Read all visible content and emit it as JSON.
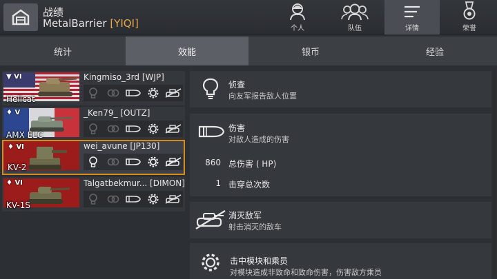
{
  "header": {
    "title": "战绩",
    "player_name": "MetalBarrier",
    "player_clan": "[YIQI]",
    "tabs": [
      {
        "label": "个人",
        "icon": "soldier-icon",
        "active": false
      },
      {
        "label": "队伍",
        "icon": "team-icon",
        "active": false
      },
      {
        "label": "详情",
        "icon": "list-icon",
        "active": true
      },
      {
        "label": "荣誉",
        "icon": "medal-icon",
        "active": false
      }
    ]
  },
  "subtabs": [
    {
      "label": "统计",
      "active": false
    },
    {
      "label": "效能",
      "active": true
    },
    {
      "label": "银币",
      "active": false
    },
    {
      "label": "经验",
      "active": false
    }
  ],
  "players": [
    {
      "tier": "▼ VI",
      "vehicle": "Hellcat",
      "name": "Kingmiso_3rd [WJP]",
      "nation": "usa",
      "selected": false,
      "achievements": {
        "spot": false,
        "assist": false,
        "damage": true,
        "modules": true,
        "kill": true
      }
    },
    {
      "tier": "♦ V",
      "vehicle": "AMX ELC",
      "name": "_Ken79_ [OUTZ]",
      "nation": "france",
      "selected": false,
      "achievements": {
        "spot": false,
        "assist": false,
        "damage": true,
        "modules": true,
        "kill": true
      }
    },
    {
      "tier": "♦ VI",
      "vehicle": "KV-2",
      "name": "wei_avune [JP130]",
      "nation": "ussr",
      "selected": true,
      "achievements": {
        "spot": true,
        "assist": false,
        "damage": true,
        "modules": true,
        "kill": true
      }
    },
    {
      "tier": "♦ VI",
      "vehicle": "KV-1S",
      "name": "Talgatbekmur...   [DIMON]",
      "nation": "ussr",
      "selected": false,
      "achievements": {
        "spot": false,
        "assist": false,
        "damage": true,
        "modules": true,
        "kill": true
      }
    }
  ],
  "panels": {
    "spot": {
      "title": "侦查",
      "desc": "向友军报告敌人位置",
      "icon": "lightbulb-icon"
    },
    "damage": {
      "title": "伤害",
      "desc": "对敌人造成的伤害",
      "icon": "shell-icon",
      "stats": [
        {
          "value": "860",
          "label": "总伤害 ( HP)"
        },
        {
          "value": "1",
          "label": "击穿总次数"
        }
      ]
    },
    "kill": {
      "title": "消灭敌军",
      "desc": "射击消灭的敌车",
      "icon": "destroyed-tank-icon"
    },
    "modules": {
      "title": "击中模块和乘员",
      "desc": "对模块造成非致命和致命伤害，伤害敌方乘员",
      "icon": "gear-icon"
    }
  },
  "colors": {
    "accent": "#d68a1d",
    "clan": "#e8a64a",
    "background": "#2c2f33"
  }
}
